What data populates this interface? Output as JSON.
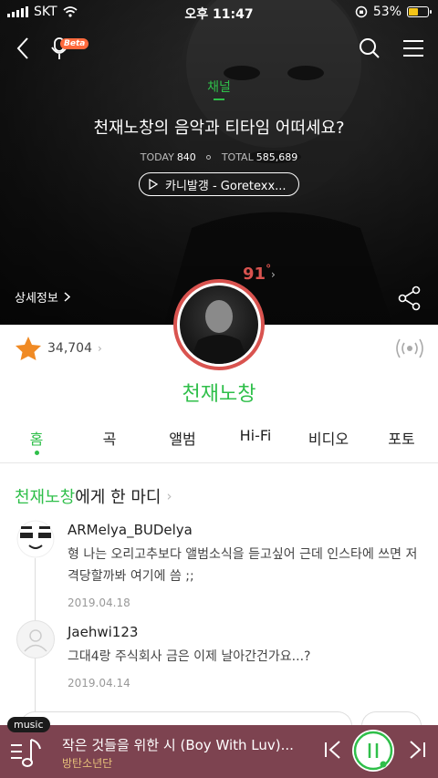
{
  "status_bar": {
    "carrier": "SKT",
    "time": "오후 11:47",
    "battery_text": "53%",
    "battery_level": 0.53
  },
  "header": {
    "beta_label": "Beta"
  },
  "channel": {
    "label": "채널",
    "title": "천재노창의 음악과 티타임 어떠세요?",
    "today_label": "TODAY",
    "today_value": "840",
    "total_label": "TOTAL",
    "total_value": "585,689",
    "now_playing": "카니발갱 - Goretexx..."
  },
  "profile": {
    "detail_label": "상세정보",
    "temperature": "91",
    "temperature_unit": "°",
    "likes": "34,704",
    "artist_name": "천재노창"
  },
  "tabs": [
    {
      "label": "홈",
      "active": true
    },
    {
      "label": "곡",
      "active": false
    },
    {
      "label": "앨범",
      "active": false
    },
    {
      "label": "Hi-Fi",
      "active": false
    },
    {
      "label": "비디오",
      "active": false
    },
    {
      "label": "포토",
      "active": false
    }
  ],
  "comments_section": {
    "title_highlight": "천재노창",
    "title_rest": "에게 한 마디",
    "comments": [
      {
        "user": "ARMelya_BUDelya",
        "text": "형 나는 오리고추보다 앨범소식을 듣고싶어 근데 인스타에 쓰면 저격당할까봐 여기에 씀 ;;",
        "date": "2019.04.18"
      },
      {
        "user": "Jaehwi123",
        "text": "그대4랑 주식회사 금은 이제 날아간건가요...?",
        "date": "2019.04.14"
      }
    ]
  },
  "mini_player": {
    "badge": "music",
    "track_title": "작은 것들을 위한 시 (Boy With Luv)...",
    "artist": "방탄소년단"
  },
  "colors": {
    "accent_green": "#2fbf4a",
    "temperature_red": "#d9534f",
    "player_bg": "#7d4350",
    "artist_gold": "#e6c07a",
    "star_orange": "#f08a24"
  },
  "icons": {
    "back": "chevron-left-icon",
    "mic": "microphone-icon",
    "search": "search-icon",
    "menu": "hamburger-menu-icon",
    "play": "play-icon",
    "share": "share-icon",
    "star": "star-icon",
    "radio": "broadcast-icon",
    "queue": "playlist-music-icon",
    "prev": "skip-previous-icon",
    "pause": "pause-icon",
    "next": "skip-next-icon"
  }
}
